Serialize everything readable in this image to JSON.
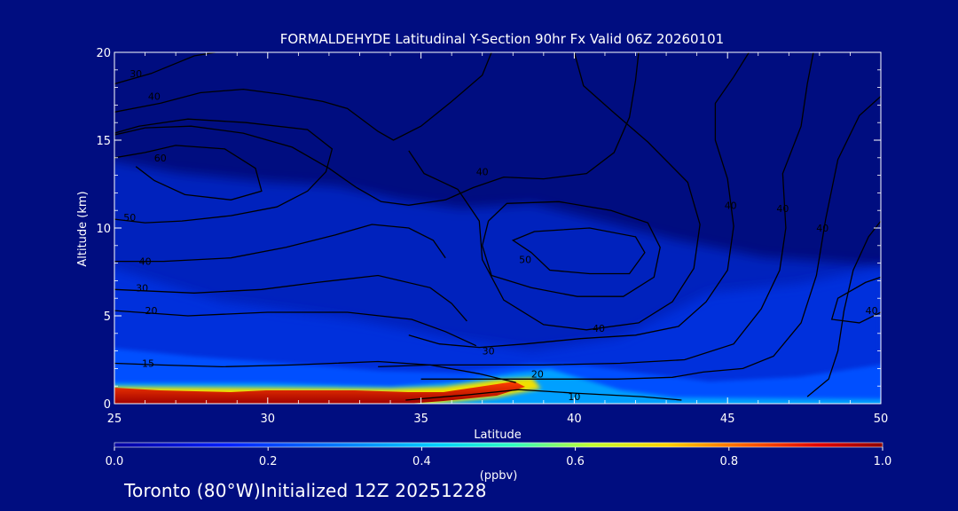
{
  "chart_data": {
    "type": "heatmap",
    "title": "FORMALDEHYDE Latitudinal Y-Section 90hr  Fx Valid 06Z 20260101",
    "xlabel": "Latitude",
    "ylabel": "Altitude (km)",
    "xlim": [
      25,
      50
    ],
    "ylim": [
      0,
      20
    ],
    "x_ticks": [
      "25",
      "30",
      "35",
      "40",
      "45",
      "50"
    ],
    "y_ticks": [
      "0",
      "5",
      "10",
      "15",
      "20"
    ],
    "colorbar": {
      "unit_label": "(ppbv)",
      "range": [
        0.0,
        1.0
      ],
      "tick_labels": [
        "0.0",
        "0.2",
        "0.4",
        "0.6",
        "0.8",
        "1.0"
      ]
    },
    "filled_field_ppbv": [
      {
        "lat": 25,
        "alt": 0.5,
        "value": 0.95
      },
      {
        "lat": 28,
        "alt": 0.5,
        "value": 0.95
      },
      {
        "lat": 32,
        "alt": 0.6,
        "value": 0.9
      },
      {
        "lat": 35,
        "alt": 0.5,
        "value": 0.85
      },
      {
        "lat": 37,
        "alt": 0.9,
        "value": 0.6
      },
      {
        "lat": 39,
        "alt": 1.3,
        "value": 0.35
      },
      {
        "lat": 41,
        "alt": 1.0,
        "value": 0.15
      },
      {
        "lat": 30,
        "alt": 2.0,
        "value": 0.12
      },
      {
        "lat": 25,
        "alt": 14.0,
        "value": 0.08
      },
      {
        "lat": 45,
        "alt": 8.0,
        "value": 0.06
      }
    ],
    "contour_labels": [
      {
        "text": "30",
        "lat": 25.7,
        "alt": 18.8
      },
      {
        "text": "40",
        "lat": 26.3,
        "alt": 17.5
      },
      {
        "text": "60",
        "lat": 26.5,
        "alt": 14.0
      },
      {
        "text": "50",
        "lat": 25.5,
        "alt": 10.6
      },
      {
        "text": "40",
        "lat": 26.0,
        "alt": 8.1
      },
      {
        "text": "30",
        "lat": 25.9,
        "alt": 6.6
      },
      {
        "text": "20",
        "lat": 26.2,
        "alt": 5.3
      },
      {
        "text": "15",
        "lat": 26.1,
        "alt": 2.3
      },
      {
        "text": "40",
        "lat": 37.0,
        "alt": 13.2
      },
      {
        "text": "50",
        "lat": 38.4,
        "alt": 8.2
      },
      {
        "text": "40",
        "lat": 40.8,
        "alt": 4.3
      },
      {
        "text": "30",
        "lat": 37.2,
        "alt": 3.0
      },
      {
        "text": "20",
        "lat": 38.8,
        "alt": 1.7
      },
      {
        "text": "40",
        "lat": 45.1,
        "alt": 11.3
      },
      {
        "text": "40",
        "lat": 46.8,
        "alt": 11.1
      },
      {
        "text": "40",
        "lat": 48.1,
        "alt": 10.0
      },
      {
        "text": "40",
        "lat": 49.7,
        "alt": 5.3
      },
      {
        "text": "10",
        "lat": 40.0,
        "alt": 0.4
      }
    ],
    "contour_lines": [
      [
        [
          25,
          18.2
        ],
        [
          26.2,
          18.8
        ],
        [
          27.6,
          19.8
        ],
        [
          28.3,
          20
        ]
      ],
      [
        [
          25,
          16.6
        ],
        [
          26.5,
          17.1
        ],
        [
          27.8,
          17.7
        ],
        [
          29.2,
          17.9
        ],
        [
          30.5,
          17.6
        ],
        [
          31.8,
          17.2
        ],
        [
          32.6,
          16.8
        ],
        [
          33.6,
          15.5
        ],
        [
          34.1,
          15.0
        ],
        [
          35,
          15.8
        ],
        [
          36,
          17.2
        ],
        [
          37,
          18.7
        ],
        [
          37.3,
          20
        ]
      ],
      [
        [
          25,
          15.3
        ],
        [
          26,
          15.7
        ],
        [
          27.5,
          15.8
        ],
        [
          29.2,
          15.4
        ],
        [
          30.8,
          14.6
        ],
        [
          32.0,
          13.4
        ],
        [
          32.9,
          12.3
        ],
        [
          33.7,
          11.5
        ],
        [
          34.6,
          11.3
        ],
        [
          35.8,
          11.6
        ],
        [
          36.7,
          12.3
        ],
        [
          37.7,
          12.9
        ],
        [
          39.0,
          12.8
        ],
        [
          40.4,
          13.1
        ],
        [
          41.3,
          14.3
        ],
        [
          41.8,
          16.3
        ],
        [
          42.0,
          18.4
        ],
        [
          42.1,
          20
        ]
      ],
      [
        [
          25,
          14.0
        ],
        [
          26.0,
          14.3
        ],
        [
          27.0,
          14.7
        ],
        [
          28.6,
          14.5
        ],
        [
          29.6,
          13.4
        ],
        [
          29.8,
          12.1
        ],
        [
          28.8,
          11.6
        ],
        [
          27.3,
          11.9
        ],
        [
          26.3,
          12.7
        ],
        [
          25.7,
          13.5
        ]
      ],
      [
        [
          25,
          10.5
        ],
        [
          26.0,
          10.3
        ],
        [
          27.2,
          10.4
        ],
        [
          28.8,
          10.7
        ],
        [
          30.3,
          11.2
        ],
        [
          31.3,
          12.1
        ],
        [
          31.9,
          13.2
        ],
        [
          32.1,
          14.5
        ],
        [
          31.3,
          15.6
        ],
        [
          29.3,
          16.0
        ],
        [
          27.4,
          16.2
        ],
        [
          25.8,
          15.8
        ],
        [
          25,
          15.4
        ]
      ],
      [
        [
          25,
          8.1
        ],
        [
          26.6,
          8.1
        ],
        [
          28.8,
          8.3
        ],
        [
          30.6,
          8.9
        ],
        [
          32.2,
          9.6
        ],
        [
          33.4,
          10.2
        ],
        [
          34.6,
          10.0
        ],
        [
          35.4,
          9.3
        ],
        [
          35.8,
          8.3
        ]
      ],
      [
        [
          25,
          6.5
        ],
        [
          27.6,
          6.3
        ],
        [
          29.8,
          6.5
        ],
        [
          31.6,
          6.9
        ],
        [
          33.6,
          7.3
        ],
        [
          35.3,
          6.6
        ],
        [
          36.0,
          5.7
        ],
        [
          36.5,
          4.7
        ]
      ],
      [
        [
          25,
          5.3
        ],
        [
          27.4,
          5.0
        ],
        [
          30.0,
          5.2
        ],
        [
          32.6,
          5.2
        ],
        [
          34.7,
          4.8
        ],
        [
          35.8,
          4.1
        ],
        [
          36.8,
          3.3
        ]
      ],
      [
        [
          25,
          2.3
        ],
        [
          26.5,
          2.2
        ],
        [
          28.5,
          2.1
        ],
        [
          30.8,
          2.2
        ],
        [
          33.6,
          2.4
        ],
        [
          35.3,
          2.2
        ],
        [
          36.9,
          1.7
        ],
        [
          38.1,
          1.2
        ]
      ],
      [
        [
          38.6,
          8.6
        ],
        [
          38.0,
          9.3
        ],
        [
          38.7,
          9.8
        ],
        [
          40.5,
          10.0
        ],
        [
          42.0,
          9.5
        ],
        [
          42.3,
          8.6
        ],
        [
          41.8,
          7.4
        ],
        [
          40.5,
          7.4
        ],
        [
          39.2,
          7.6
        ],
        [
          38.6,
          8.6
        ]
      ],
      [
        [
          37.2,
          10.4
        ],
        [
          37.0,
          9.0
        ],
        [
          37.3,
          7.3
        ],
        [
          38.6,
          6.6
        ],
        [
          40.1,
          6.1
        ],
        [
          41.6,
          6.1
        ],
        [
          42.6,
          7.2
        ],
        [
          42.8,
          8.9
        ],
        [
          42.4,
          10.3
        ],
        [
          41.2,
          11.0
        ],
        [
          39.5,
          11.5
        ],
        [
          37.8,
          11.4
        ],
        [
          37.2,
          10.4
        ]
      ],
      [
        [
          34.6,
          14.4
        ],
        [
          35.1,
          13.1
        ],
        [
          36.2,
          12.2
        ],
        [
          36.9,
          10.4
        ],
        [
          37.0,
          8.2
        ],
        [
          37.7,
          5.9
        ],
        [
          39.0,
          4.5
        ],
        [
          40.4,
          4.2
        ],
        [
          42.1,
          4.6
        ],
        [
          43.2,
          5.8
        ],
        [
          43.9,
          7.7
        ],
        [
          44.1,
          10.2
        ],
        [
          43.7,
          12.6
        ],
        [
          42.4,
          14.9
        ],
        [
          41.2,
          16.7
        ],
        [
          40.3,
          18.1
        ],
        [
          40.0,
          20
        ]
      ],
      [
        [
          34.6,
          3.9
        ],
        [
          35.6,
          3.4
        ],
        [
          36.9,
          3.2
        ],
        [
          38.4,
          3.4
        ],
        [
          40.2,
          3.7
        ],
        [
          42.0,
          3.9
        ],
        [
          43.4,
          4.4
        ],
        [
          44.3,
          5.8
        ],
        [
          45.0,
          7.6
        ],
        [
          45.2,
          10.1
        ],
        [
          45.0,
          12.8
        ],
        [
          44.6,
          15.0
        ],
        [
          44.6,
          17.1
        ],
        [
          45.2,
          18.6
        ],
        [
          45.7,
          20
        ]
      ],
      [
        [
          33.6,
          2.1
        ],
        [
          35.3,
          2.2
        ],
        [
          37.1,
          2.2
        ],
        [
          39.0,
          2.2
        ],
        [
          41.5,
          2.3
        ],
        [
          43.6,
          2.5
        ],
        [
          45.2,
          3.4
        ],
        [
          46.1,
          5.4
        ],
        [
          46.7,
          7.6
        ],
        [
          46.9,
          10.0
        ],
        [
          46.8,
          13.1
        ],
        [
          47.4,
          15.8
        ],
        [
          47.6,
          18.2
        ],
        [
          47.8,
          20
        ]
      ],
      [
        [
          35.0,
          1.4
        ],
        [
          37.0,
          1.4
        ],
        [
          39.0,
          1.4
        ],
        [
          41.4,
          1.4
        ],
        [
          43.2,
          1.5
        ],
        [
          44.2,
          1.8
        ],
        [
          45.5,
          2.0
        ],
        [
          46.5,
          2.7
        ],
        [
          47.4,
          4.6
        ],
        [
          47.9,
          7.3
        ],
        [
          48.2,
          10.5
        ],
        [
          48.6,
          13.9
        ],
        [
          49.3,
          16.4
        ],
        [
          50,
          17.5
        ]
      ],
      [
        [
          47.6,
          0.4
        ],
        [
          48.3,
          1.4
        ],
        [
          48.6,
          3.0
        ],
        [
          48.8,
          5.3
        ],
        [
          49.1,
          7.6
        ],
        [
          49.6,
          9.5
        ],
        [
          50,
          10.4
        ]
      ],
      [
        [
          50,
          7.2
        ],
        [
          49.5,
          6.9
        ],
        [
          48.6,
          6.0
        ],
        [
          48.4,
          4.8
        ],
        [
          49.3,
          4.6
        ],
        [
          50,
          5.2
        ]
      ],
      [
        [
          34.5,
          0.2
        ],
        [
          36.5,
          0.5
        ],
        [
          38.2,
          0.8
        ],
        [
          40.0,
          0.6
        ],
        [
          42.2,
          0.4
        ],
        [
          43.5,
          0.2
        ]
      ]
    ]
  },
  "footer": "Toronto (80°W)Initialized 12Z 20251228"
}
